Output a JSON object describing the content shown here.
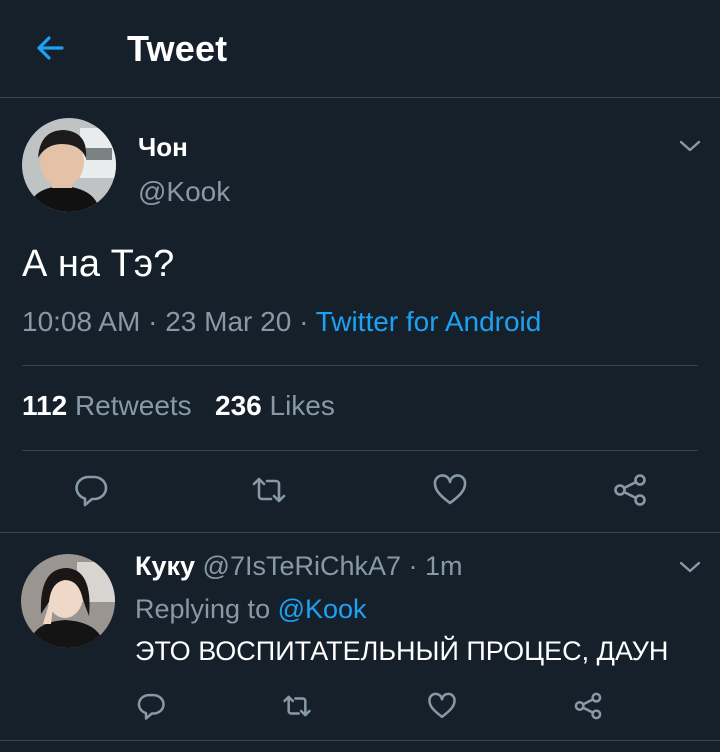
{
  "header": {
    "title": "Tweet",
    "back_icon": "arrow-left-icon"
  },
  "colors": {
    "background": "#15202b",
    "accent": "#1da1f2",
    "muted": "#8899a6",
    "divider": "#38444d"
  },
  "tweet": {
    "author_name": "Чон",
    "author_handle": "@Kook",
    "text": "А на Тэ?",
    "time": "10:08 AM",
    "date": "23 Mar 20",
    "separator": "·",
    "source": "Twitter for Android",
    "retweets_count": "112",
    "retweets_label": "Retweets",
    "likes_count": "236",
    "likes_label": "Likes"
  },
  "reply": {
    "author_name": "Куку",
    "author_handle": "@7IsTeRiChkA7",
    "time": "· 1m",
    "replying_prefix": "Replying to",
    "replying_handle": "@Kook",
    "text": "ЭТО ВОСПИТАТЕЛЬНЫЙ ПРОЦЕС, ДАУН"
  },
  "actions": [
    "reply-icon",
    "retweet-icon",
    "like-icon",
    "share-icon"
  ]
}
